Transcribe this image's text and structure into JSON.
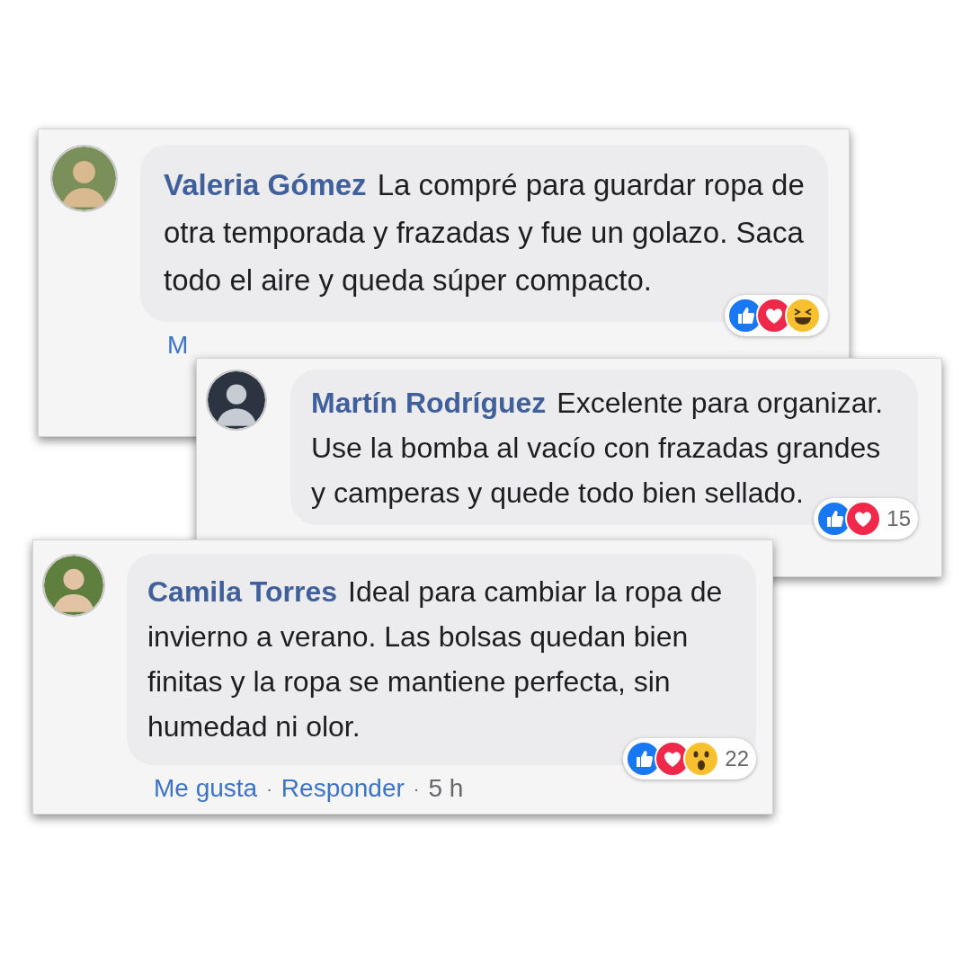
{
  "comments": [
    {
      "author": "Valeria Gómez",
      "text": "La compré para guardar ropa de otra temporada y frazadas y fue un golazo. Saca todo el aire y queda súper compacto.",
      "reactions": [
        {
          "kind": "like"
        },
        {
          "kind": "love"
        },
        {
          "kind": "haha"
        }
      ],
      "actions": [
        {
          "kind": "link",
          "text": "M"
        }
      ]
    },
    {
      "author": "Martín Rodríguez",
      "text": "Excelente para organizar. Use la bomba al vacío con frazadas grandes y camperas y quede todo bien sellado.",
      "reactions": [
        {
          "kind": "like"
        },
        {
          "kind": "love"
        }
      ],
      "reaction_count": "15"
    },
    {
      "author": "Camila Torres",
      "text": "Ideal para cambiar la ropa de invierno a verano. Las bolsas quedan bien finitas y la ropa se mantiene perfecta, sin humedad ni olor.",
      "reactions": [
        {
          "kind": "like"
        },
        {
          "kind": "love"
        },
        {
          "kind": "wow"
        }
      ],
      "reaction_count": "22",
      "actions": [
        {
          "kind": "link",
          "text": "Me gusta"
        },
        {
          "kind": "sep",
          "text": "·"
        },
        {
          "kind": "link",
          "text": "Responder"
        },
        {
          "kind": "sep",
          "text": "·"
        },
        {
          "kind": "time",
          "text": "5 h"
        }
      ]
    }
  ]
}
